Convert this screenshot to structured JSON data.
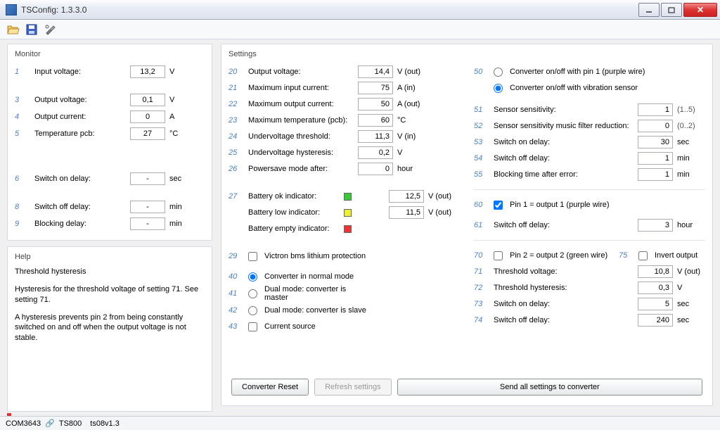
{
  "window": {
    "title": "TSConfig: 1.3.3.0"
  },
  "monitor": {
    "header": "Monitor",
    "r1": {
      "idx": "1",
      "label": "Input voltage:",
      "value": "13,2",
      "unit": "V"
    },
    "r3": {
      "idx": "3",
      "label": "Output voltage:",
      "value": "0,1",
      "unit": "V"
    },
    "r4": {
      "idx": "4",
      "label": "Output current:",
      "value": "0",
      "unit": "A"
    },
    "r5": {
      "idx": "5",
      "label": "Temperature pcb:",
      "value": "27",
      "unit": "°C"
    },
    "r6": {
      "idx": "6",
      "label": "Switch on delay:",
      "value": "-",
      "unit": "sec"
    },
    "r8": {
      "idx": "8",
      "label": "Switch off delay:",
      "value": "-",
      "unit": "min"
    },
    "r9": {
      "idx": "9",
      "label": "Blocking delay:",
      "value": "-",
      "unit": "min"
    }
  },
  "help": {
    "header": "Help",
    "title": "Threshold hysteresis",
    "p1": "Hysteresis for the threshold voltage of setting 71. See setting 71.",
    "p2": "A hysteresis prevents pin 2 from being constantly switched on and off when the output voltage is not stable."
  },
  "settings": {
    "header": "Settings",
    "r20": {
      "idx": "20",
      "label": "Output voltage:",
      "value": "14,4",
      "unit": "V (out)"
    },
    "r21": {
      "idx": "21",
      "label": "Maximum input current:",
      "value": "75",
      "unit": "A (in)"
    },
    "r22": {
      "idx": "22",
      "label": "Maximum output current:",
      "value": "50",
      "unit": "A (out)"
    },
    "r23": {
      "idx": "23",
      "label": "Maximum temperature (pcb):",
      "value": "60",
      "unit": "°C"
    },
    "r24": {
      "idx": "24",
      "label": "Undervoltage threshold:",
      "value": "11,3",
      "unit": "V (in)"
    },
    "r25": {
      "idx": "25",
      "label": "Undervoltage hysteresis:",
      "value": "0,2",
      "unit": "V"
    },
    "r26": {
      "idx": "26",
      "label": "Powersave mode after:",
      "value": "0",
      "unit": "hour"
    },
    "r27": {
      "idx": "27",
      "label_ok": "Battery ok indicator:",
      "label_low": "Battery low indicator:",
      "label_empty": "Battery empty indicator:",
      "val_ok": "12,5",
      "unit_ok": "V (out)",
      "val_low": "11,5",
      "unit_low": "V (out)"
    },
    "r29": {
      "idx": "29",
      "label": "Victron bms lithium protection"
    },
    "r40": {
      "idx": "40",
      "label": "Converter in normal mode"
    },
    "r41": {
      "idx": "41",
      "label": "Dual mode: converter is master"
    },
    "r42": {
      "idx": "42",
      "label": "Dual mode: converter is slave"
    },
    "r43": {
      "idx": "43",
      "label": "Current source"
    },
    "r50": {
      "idx": "50",
      "opt1": "Converter on/off with pin 1 (purple wire)",
      "opt2": "Converter on/off with vibration sensor"
    },
    "r51": {
      "idx": "51",
      "label": "Sensor sensitivity:",
      "value": "1",
      "hint": "(1..5)"
    },
    "r52": {
      "idx": "52",
      "label": "Sensor sensitivity music filter reduction:",
      "value": "0",
      "hint": "(0..2)"
    },
    "r53": {
      "idx": "53",
      "label": "Switch on delay:",
      "value": "30",
      "unit": "sec"
    },
    "r54": {
      "idx": "54",
      "label": "Switch off delay:",
      "value": "1",
      "unit": "min"
    },
    "r55": {
      "idx": "55",
      "label": "Blocking time after error:",
      "value": "1",
      "unit": "min"
    },
    "r60": {
      "idx": "60",
      "label": "Pin 1 = output 1 (purple wire)"
    },
    "r61": {
      "idx": "61",
      "label": "Switch off delay:",
      "value": "3",
      "unit": "hour"
    },
    "r70": {
      "idx": "70",
      "label": "Pin 2 = output 2 (green wire)"
    },
    "r75": {
      "idx": "75",
      "label": "Invert output"
    },
    "r71": {
      "idx": "71",
      "label": "Threshold voltage:",
      "value": "10,8",
      "unit": "V (out)"
    },
    "r72": {
      "idx": "72",
      "label": "Threshold hysteresis:",
      "value": "0,3",
      "unit": "V"
    },
    "r73": {
      "idx": "73",
      "label": "Switch on delay:",
      "value": "5",
      "unit": "sec"
    },
    "r74": {
      "idx": "74",
      "label": "Switch off delay:",
      "value": "240",
      "unit": "sec"
    }
  },
  "buttons": {
    "reset": "Converter Reset",
    "refresh": "Refresh settings",
    "send": "Send all settings to converter"
  },
  "status": {
    "port": "COM3643",
    "device": "TS800",
    "fw": "ts08v1.3"
  }
}
